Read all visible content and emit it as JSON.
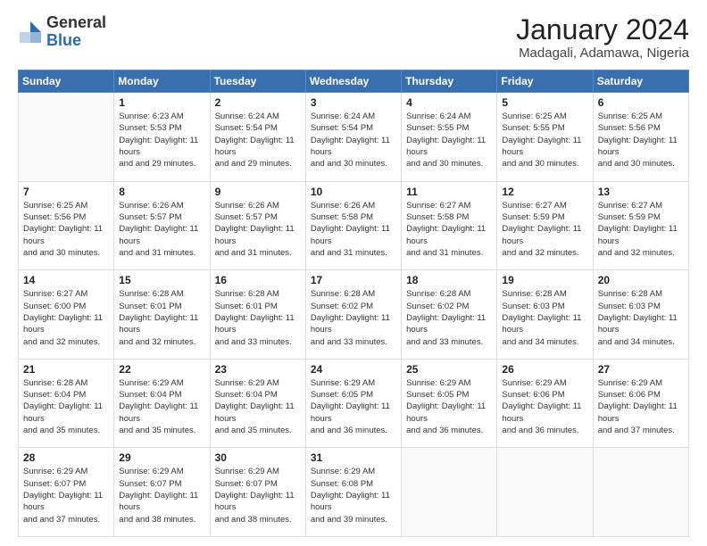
{
  "logo": {
    "general": "General",
    "blue": "Blue"
  },
  "header": {
    "month": "January 2024",
    "location": "Madagali, Adamawa, Nigeria"
  },
  "weekdays": [
    "Sunday",
    "Monday",
    "Tuesday",
    "Wednesday",
    "Thursday",
    "Friday",
    "Saturday"
  ],
  "weeks": [
    [
      {
        "day": "",
        "sunrise": "",
        "sunset": "",
        "daylight": ""
      },
      {
        "day": "1",
        "sunrise": "Sunrise: 6:23 AM",
        "sunset": "Sunset: 5:53 PM",
        "daylight": "Daylight: 11 hours and 29 minutes."
      },
      {
        "day": "2",
        "sunrise": "Sunrise: 6:24 AM",
        "sunset": "Sunset: 5:54 PM",
        "daylight": "Daylight: 11 hours and 29 minutes."
      },
      {
        "day": "3",
        "sunrise": "Sunrise: 6:24 AM",
        "sunset": "Sunset: 5:54 PM",
        "daylight": "Daylight: 11 hours and 30 minutes."
      },
      {
        "day": "4",
        "sunrise": "Sunrise: 6:24 AM",
        "sunset": "Sunset: 5:55 PM",
        "daylight": "Daylight: 11 hours and 30 minutes."
      },
      {
        "day": "5",
        "sunrise": "Sunrise: 6:25 AM",
        "sunset": "Sunset: 5:55 PM",
        "daylight": "Daylight: 11 hours and 30 minutes."
      },
      {
        "day": "6",
        "sunrise": "Sunrise: 6:25 AM",
        "sunset": "Sunset: 5:56 PM",
        "daylight": "Daylight: 11 hours and 30 minutes."
      }
    ],
    [
      {
        "day": "7",
        "sunrise": "Sunrise: 6:25 AM",
        "sunset": "Sunset: 5:56 PM",
        "daylight": "Daylight: 11 hours and 30 minutes."
      },
      {
        "day": "8",
        "sunrise": "Sunrise: 6:26 AM",
        "sunset": "Sunset: 5:57 PM",
        "daylight": "Daylight: 11 hours and 31 minutes."
      },
      {
        "day": "9",
        "sunrise": "Sunrise: 6:26 AM",
        "sunset": "Sunset: 5:57 PM",
        "daylight": "Daylight: 11 hours and 31 minutes."
      },
      {
        "day": "10",
        "sunrise": "Sunrise: 6:26 AM",
        "sunset": "Sunset: 5:58 PM",
        "daylight": "Daylight: 11 hours and 31 minutes."
      },
      {
        "day": "11",
        "sunrise": "Sunrise: 6:27 AM",
        "sunset": "Sunset: 5:58 PM",
        "daylight": "Daylight: 11 hours and 31 minutes."
      },
      {
        "day": "12",
        "sunrise": "Sunrise: 6:27 AM",
        "sunset": "Sunset: 5:59 PM",
        "daylight": "Daylight: 11 hours and 32 minutes."
      },
      {
        "day": "13",
        "sunrise": "Sunrise: 6:27 AM",
        "sunset": "Sunset: 5:59 PM",
        "daylight": "Daylight: 11 hours and 32 minutes."
      }
    ],
    [
      {
        "day": "14",
        "sunrise": "Sunrise: 6:27 AM",
        "sunset": "Sunset: 6:00 PM",
        "daylight": "Daylight: 11 hours and 32 minutes."
      },
      {
        "day": "15",
        "sunrise": "Sunrise: 6:28 AM",
        "sunset": "Sunset: 6:01 PM",
        "daylight": "Daylight: 11 hours and 32 minutes."
      },
      {
        "day": "16",
        "sunrise": "Sunrise: 6:28 AM",
        "sunset": "Sunset: 6:01 PM",
        "daylight": "Daylight: 11 hours and 33 minutes."
      },
      {
        "day": "17",
        "sunrise": "Sunrise: 6:28 AM",
        "sunset": "Sunset: 6:02 PM",
        "daylight": "Daylight: 11 hours and 33 minutes."
      },
      {
        "day": "18",
        "sunrise": "Sunrise: 6:28 AM",
        "sunset": "Sunset: 6:02 PM",
        "daylight": "Daylight: 11 hours and 33 minutes."
      },
      {
        "day": "19",
        "sunrise": "Sunrise: 6:28 AM",
        "sunset": "Sunset: 6:03 PM",
        "daylight": "Daylight: 11 hours and 34 minutes."
      },
      {
        "day": "20",
        "sunrise": "Sunrise: 6:28 AM",
        "sunset": "Sunset: 6:03 PM",
        "daylight": "Daylight: 11 hours and 34 minutes."
      }
    ],
    [
      {
        "day": "21",
        "sunrise": "Sunrise: 6:28 AM",
        "sunset": "Sunset: 6:04 PM",
        "daylight": "Daylight: 11 hours and 35 minutes."
      },
      {
        "day": "22",
        "sunrise": "Sunrise: 6:29 AM",
        "sunset": "Sunset: 6:04 PM",
        "daylight": "Daylight: 11 hours and 35 minutes."
      },
      {
        "day": "23",
        "sunrise": "Sunrise: 6:29 AM",
        "sunset": "Sunset: 6:04 PM",
        "daylight": "Daylight: 11 hours and 35 minutes."
      },
      {
        "day": "24",
        "sunrise": "Sunrise: 6:29 AM",
        "sunset": "Sunset: 6:05 PM",
        "daylight": "Daylight: 11 hours and 36 minutes."
      },
      {
        "day": "25",
        "sunrise": "Sunrise: 6:29 AM",
        "sunset": "Sunset: 6:05 PM",
        "daylight": "Daylight: 11 hours and 36 minutes."
      },
      {
        "day": "26",
        "sunrise": "Sunrise: 6:29 AM",
        "sunset": "Sunset: 6:06 PM",
        "daylight": "Daylight: 11 hours and 36 minutes."
      },
      {
        "day": "27",
        "sunrise": "Sunrise: 6:29 AM",
        "sunset": "Sunset: 6:06 PM",
        "daylight": "Daylight: 11 hours and 37 minutes."
      }
    ],
    [
      {
        "day": "28",
        "sunrise": "Sunrise: 6:29 AM",
        "sunset": "Sunset: 6:07 PM",
        "daylight": "Daylight: 11 hours and 37 minutes."
      },
      {
        "day": "29",
        "sunrise": "Sunrise: 6:29 AM",
        "sunset": "Sunset: 6:07 PM",
        "daylight": "Daylight: 11 hours and 38 minutes."
      },
      {
        "day": "30",
        "sunrise": "Sunrise: 6:29 AM",
        "sunset": "Sunset: 6:07 PM",
        "daylight": "Daylight: 11 hours and 38 minutes."
      },
      {
        "day": "31",
        "sunrise": "Sunrise: 6:29 AM",
        "sunset": "Sunset: 6:08 PM",
        "daylight": "Daylight: 11 hours and 39 minutes."
      },
      {
        "day": "",
        "sunrise": "",
        "sunset": "",
        "daylight": ""
      },
      {
        "day": "",
        "sunrise": "",
        "sunset": "",
        "daylight": ""
      },
      {
        "day": "",
        "sunrise": "",
        "sunset": "",
        "daylight": ""
      }
    ]
  ]
}
